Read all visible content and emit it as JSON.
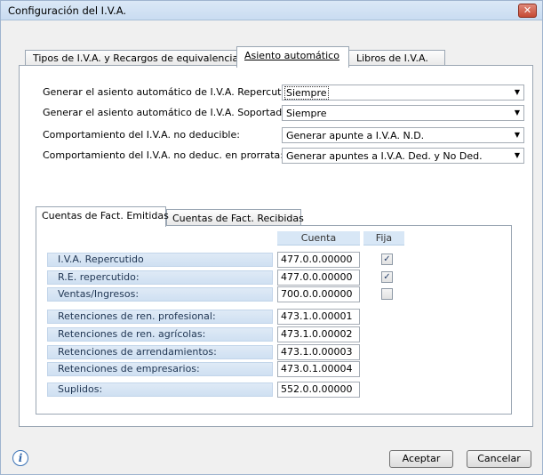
{
  "window": {
    "title": "Configuración del I.V.A.",
    "close_glyph": "✕"
  },
  "tabs": [
    {
      "label": "Tipos de I.V.A. y Recargos de equivalencia"
    },
    {
      "label": "Asiento automático"
    },
    {
      "label": "Libros de I.V.A."
    }
  ],
  "form": {
    "rows": [
      {
        "label": "Generar el asiento automático de I.V.A. Repercutido:",
        "value": "Siempre"
      },
      {
        "label": "Generar el asiento automático de I.V.A. Soportado:",
        "value": "Siempre"
      },
      {
        "label": "Comportamiento del I.V.A. no deducible:",
        "value": "Generar apunte a I.V.A. N.D."
      },
      {
        "label": "Comportamiento del I.V.A. no deduc. en prorrata:",
        "value": "Generar apuntes a I.V.A. Ded. y No Ded."
      }
    ]
  },
  "inner_tabs": [
    {
      "label": "Cuentas de Fact. Emitidas"
    },
    {
      "label": "Cuentas de Fact. Recibidas"
    }
  ],
  "accounts": {
    "headers": {
      "cuenta": "Cuenta",
      "fija": "Fija"
    },
    "rows": [
      {
        "label": "I.V.A. Repercutido",
        "cuenta": "477.0.0.00000",
        "fija": "checked"
      },
      {
        "label": "R.E. repercutido:",
        "cuenta": "477.0.0.00000",
        "fija": "checked"
      },
      {
        "label": "Ventas/Ingresos:",
        "cuenta": "700.0.0.00000",
        "fija": "unchecked"
      },
      {
        "label": "Retenciones de ren. profesional:",
        "cuenta": "473.1.0.00001"
      },
      {
        "label": "Retenciones de ren. agrícolas:",
        "cuenta": "473.1.0.00002"
      },
      {
        "label": "Retenciones de arrendamientos:",
        "cuenta": "473.1.0.00003"
      },
      {
        "label": "Retenciones de empresarios:",
        "cuenta": "473.0.1.00004"
      },
      {
        "label": "Suplidos:",
        "cuenta": "552.0.0.00000"
      }
    ]
  },
  "buttons": {
    "accept": "Aceptar",
    "cancel": "Cancelar"
  },
  "icons": {
    "info": "i",
    "dropdown": "▼",
    "check": "✓"
  }
}
